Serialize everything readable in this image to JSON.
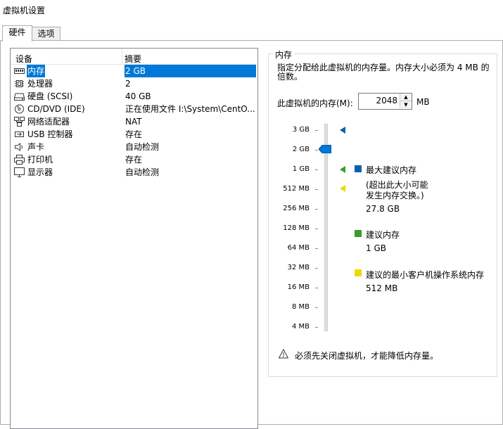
{
  "window": {
    "title": "虚拟机设置"
  },
  "tabs": [
    {
      "label": "硬件",
      "active": true
    },
    {
      "label": "选项",
      "active": false
    }
  ],
  "device_list": {
    "col_device": "设备",
    "col_summary": "摘要",
    "rows": [
      {
        "name": "内存",
        "summary": "2 GB",
        "icon": "memory-icon",
        "selected": true
      },
      {
        "name": "处理器",
        "summary": "2",
        "icon": "cpu-icon",
        "selected": false
      },
      {
        "name": "硬盘 (SCSI)",
        "summary": "40 GB",
        "icon": "hard-disk-icon",
        "selected": false
      },
      {
        "name": "CD/DVD (IDE)",
        "summary": "正在使用文件 I:\\System\\CentO...",
        "icon": "cd-dvd-icon",
        "selected": false
      },
      {
        "name": "网络适配器",
        "summary": "NAT",
        "icon": "network-adapter-icon",
        "selected": false
      },
      {
        "name": "USB 控制器",
        "summary": "存在",
        "icon": "usb-icon",
        "selected": false
      },
      {
        "name": "声卡",
        "summary": "自动检测",
        "icon": "speaker-icon",
        "selected": false
      },
      {
        "name": "打印机",
        "summary": "存在",
        "icon": "printer-icon",
        "selected": false
      },
      {
        "name": "显示器",
        "summary": "自动检测",
        "icon": "monitor-icon",
        "selected": false
      }
    ]
  },
  "memory": {
    "group_title": "内存",
    "description": "指定分配给此虚拟机的内存量。内存大小必须为 4 MB 的倍数。",
    "field_label": "此虚拟机的内存(M):",
    "value": "2048",
    "unit": "MB",
    "scale_labels": [
      "3 GB",
      "2 GB",
      "1 GB",
      "512 MB",
      "256 MB",
      "128 MB",
      "64 MB",
      "32 MB",
      "16 MB",
      "8 MB",
      "4 MB"
    ],
    "slider_value": "2 GB",
    "legend": {
      "max_title": "最大建议内存",
      "max_note": "(超出此大小可能发生内存交换。)",
      "max_note_line1": "(超出此大小可能",
      "max_note_line2": "发生内存交换。)",
      "max_value": "27.8 GB",
      "rec_title": "建议内存",
      "rec_value": "1 GB",
      "min_title": "建议的最小客户机操作系统内存",
      "min_value": "512 MB"
    },
    "colors": {
      "max": "#0063b1",
      "rec": "#3a9b2e",
      "min": "#f0d800",
      "selection": "#0078d7"
    },
    "warning": "必须先关闭虚拟机，才能降低内存量。"
  }
}
